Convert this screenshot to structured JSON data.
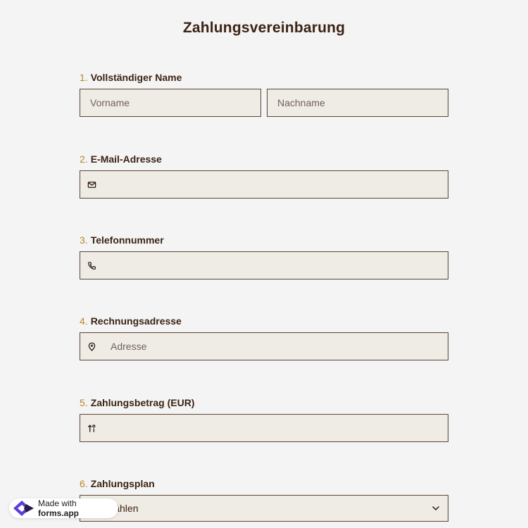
{
  "form": {
    "title": "Zahlungsvereinbarung",
    "questions": [
      {
        "number": "1.",
        "label": "Vollständiger Name",
        "first_placeholder": "Vorname",
        "last_placeholder": "Nachname"
      },
      {
        "number": "2.",
        "label": "E-Mail-Adresse",
        "icon": "envelope-icon",
        "placeholder": ""
      },
      {
        "number": "3.",
        "label": "Telefonnummer",
        "icon": "phone-icon",
        "placeholder": ""
      },
      {
        "number": "4.",
        "label": "Rechnungsadresse",
        "icon": "map-pin-icon",
        "placeholder": "Adresse"
      },
      {
        "number": "5.",
        "label": "Zahlungsbetrag (EUR)",
        "icon": "number-sort-icon",
        "placeholder": ""
      },
      {
        "number": "6.",
        "label": "Zahlungsplan",
        "select_value": "Auswählen"
      }
    ]
  },
  "badge": {
    "prefix": "Made with",
    "brand": "forms.app"
  },
  "colors": {
    "background": "#f4f4f4",
    "field_bg": "#efebe5",
    "border": "#5a4636",
    "text": "#3b2314",
    "number_accent": "#b8862b"
  }
}
